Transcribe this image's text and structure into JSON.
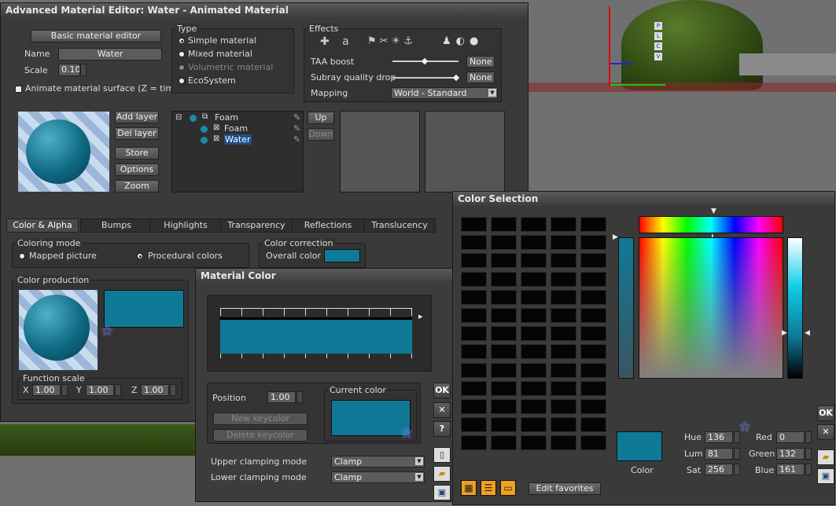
{
  "main_window": {
    "title": "Advanced Material Editor: Water - Animated Material",
    "basic_editor_label": "Basic material editor",
    "name_label": "Name",
    "name_value": "Water",
    "scale_label": "Scale",
    "scale_value": "0.10",
    "animate_label": "Animate material surface (Z = time)",
    "type_group": "Type",
    "types": [
      "Simple material",
      "Mixed material",
      "Volumetric material",
      "EcoSystem"
    ],
    "effects_group": "Effects",
    "taa_label": "TAA boost",
    "taa_value": "None",
    "subray_label": "Subray quality drop",
    "subray_value": "None",
    "mapping_label": "Mapping",
    "mapping_value": "World - Standard",
    "layer_buttons": [
      "Add layer",
      "Del layer",
      "Store",
      "Options",
      "Zoom"
    ],
    "layers": [
      "Foam",
      "Foam",
      "Water"
    ],
    "up_label": "Up",
    "down_label": "Down",
    "tabs": [
      "Color & Alpha",
      "Bumps",
      "Highlights",
      "Transparency",
      "Reflections",
      "Translucency"
    ],
    "coloring_mode_group": "Coloring mode",
    "mapped_picture": "Mapped picture",
    "procedural_colors": "Procedural colors",
    "color_correction_group": "Color correction",
    "overall_color": "Overall color",
    "color_production_group": "Color production",
    "function_scale_group": "Function scale",
    "fx_label": "X",
    "fx_value": "1.00",
    "fy_label": "Y",
    "fy_value": "1.00",
    "fz_label": "Z",
    "fz_value": "1.00"
  },
  "material_color": {
    "title": "Material Color",
    "position_label": "Position",
    "position_value": "1.00",
    "current_color_label": "Current color",
    "new_keycolor": "New keycolor",
    "delete_keycolor": "Delete keycolor",
    "upper_label": "Upper clamping mode",
    "upper_value": "Clamp",
    "lower_label": "Lower clamping mode",
    "lower_value": "Clamp",
    "ok_label": "OK",
    "close_label": "✕",
    "help_label": "?"
  },
  "color_selection": {
    "title": "Color Selection",
    "color_label": "Color",
    "hue_label": "Hue",
    "hue_value": "136",
    "lum_label": "Lum",
    "lum_value": "81",
    "sat_label": "Sat",
    "sat_value": "256",
    "red_label": "Red",
    "red_value": "0",
    "green_label": "Green",
    "green_value": "132",
    "blue_label": "Blue",
    "blue_value": "161",
    "edit_favorites": "Edit favorites",
    "ok_label": "OK",
    "close_label": "✕"
  },
  "viewport": {
    "axis_letters": [
      "P",
      "L",
      "C",
      "V"
    ]
  },
  "colors": {
    "accent": "#0f7a97",
    "window_bg": "#3a3a3a",
    "title_bg": "#4a4a4a"
  }
}
